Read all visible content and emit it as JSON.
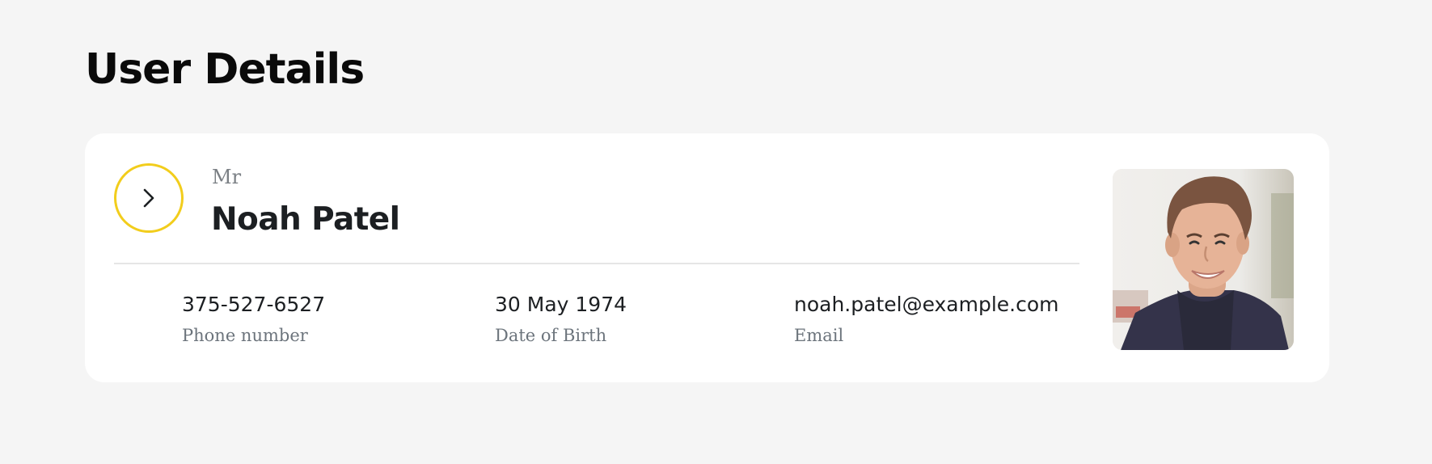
{
  "page": {
    "title": "User Details"
  },
  "user": {
    "salutation": "Mr",
    "name": "Noah Patel",
    "details": [
      {
        "value": "375-527-6527",
        "label": "Phone number"
      },
      {
        "value": "30 May 1974",
        "label": "Date of Birth"
      },
      {
        "value": "noah.patel@example.com",
        "label": "Email"
      }
    ]
  },
  "icons": {
    "toggle": "chevron-right-icon"
  },
  "colors": {
    "page_background": "#f5f5f5",
    "card_background": "#ffffff",
    "accent_ring": "#f2cd1c",
    "title_text": "#0a0a0a",
    "label_text": "#6c747c"
  }
}
